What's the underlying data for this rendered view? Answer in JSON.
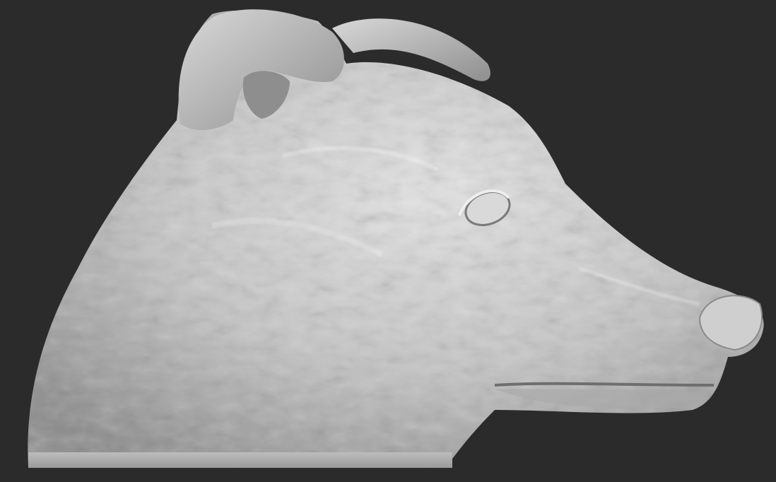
{
  "viewport": {
    "background_color": "#2b2b2b",
    "model_subject": "dog head sculpt",
    "material_color": "#bdbdbd",
    "highlight_color": "#e6e6e6",
    "shadow_color": "#6f6f6f"
  },
  "icons": [
    "dog-head-sculpt-model"
  ]
}
